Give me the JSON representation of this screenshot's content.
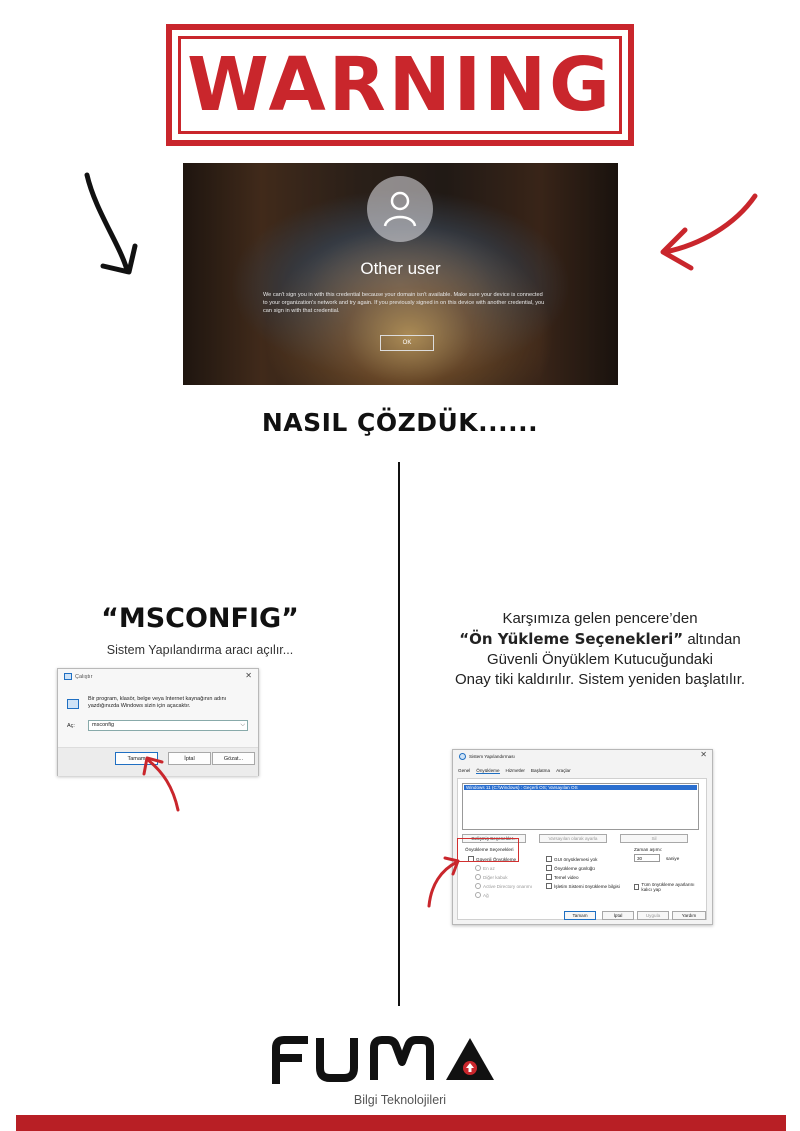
{
  "warning": "WARNING",
  "login_screen": {
    "user": "Other user",
    "message": "We can't sign you in with this credential because your domain isn't available. Make sure your device is connected to your organization's network and try again. If you previously signed in on this device with another credential, you can sign in with that credential.",
    "ok": "OK"
  },
  "heading": "NASIL ÇÖZDÜK......",
  "left": {
    "command": "“MSCONFIG”",
    "subtitle": "Sistem Yapılandırma aracı açılır..."
  },
  "run_dialog": {
    "title": "Çalıştır",
    "close": "✕",
    "description": "Bir program, klasör, belge veya Internet kaynağının adını yazdığınızda Windows sizin için açacaktır.",
    "open_label": "Aç:",
    "input_value": "msconfig",
    "ok": "Tamam",
    "cancel": "İptal",
    "browse": "Gözat..."
  },
  "right": {
    "line1": "Karşımıza gelen pencere’den",
    "highlight": "“Ön Yükleme Seçenekleri”",
    "line2_rest": " altından",
    "line3": "Güvenli Önyüklem Kutucuğundaki",
    "line4": "Onay tiki kaldırılır. Sistem yeniden başlatılır."
  },
  "msconfig": {
    "title": "Sistem Yapılandırması",
    "close": "✕",
    "tabs": [
      "Genel",
      "Önyükleme",
      "Hizmetler",
      "Başlatma",
      "Araçlar"
    ],
    "os_entry": "Windows 11 (C:\\Windows) : Geçerli OS; Varsayılan OS",
    "advanced": "Gelişmiş Seçenekler...",
    "set_default": "Varsayılan olarak ayarla",
    "delete": "Sil",
    "boot_options": "Önyükleme Seçenekleri",
    "safe_boot": "Güvenli Önyükleme",
    "radios": [
      "En az",
      "Diğer kabuk",
      "Active Directory onarımı",
      "Ağ"
    ],
    "checks": [
      "GUI önyüklemesi yok",
      "Önyükleme günlüğü",
      "Temel video",
      "İşletim Sistemi önyükleme bilgisi"
    ],
    "timeout_label": "Zaman aşımı:",
    "timeout_value": "30",
    "seconds": "saniye",
    "permanent": "Tüm önyükleme ayarlarını kalıcı yap",
    "ok": "Tamam",
    "cancel": "İptal",
    "apply": "Uygula",
    "help": "Yardım"
  },
  "logo": {
    "name": "FUMA",
    "tagline": "Bilgi Teknolojileri"
  },
  "colors": {
    "brand_red": "#c9262c",
    "bar_red": "#b81f25",
    "text_dark": "#111111"
  },
  "icons": [
    "arrow-black-icon",
    "arrow-red-icon",
    "user-icon",
    "run-app-icon",
    "close-icon"
  ]
}
